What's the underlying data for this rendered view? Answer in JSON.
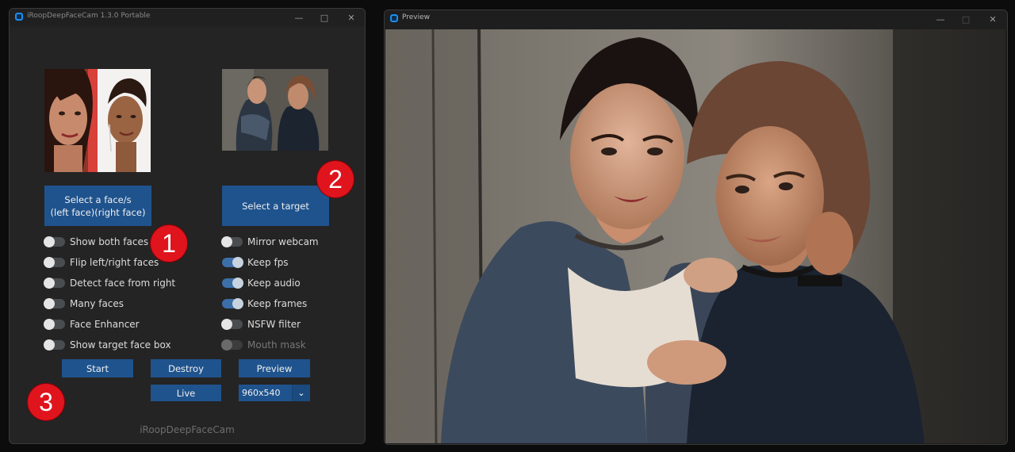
{
  "main_window": {
    "title": "iRoopDeepFaceCam 1.3.0 Portable",
    "source_button": "Select a face/s\n(left face)(right face)",
    "target_button": "Select a target",
    "left_switches": [
      {
        "label": "Show both faces",
        "on": false
      },
      {
        "label": "Flip left/right faces",
        "on": false
      },
      {
        "label": "Detect face from right",
        "on": false
      },
      {
        "label": "Many faces",
        "on": false
      },
      {
        "label": "Face Enhancer",
        "on": false
      },
      {
        "label": "Show target face box",
        "on": false
      }
    ],
    "right_switches": [
      {
        "label": "Mirror webcam",
        "on": false
      },
      {
        "label": "Keep fps",
        "on": true
      },
      {
        "label": "Keep audio",
        "on": true
      },
      {
        "label": "Keep frames",
        "on": true
      },
      {
        "label": "NSFW filter",
        "on": false
      },
      {
        "label": "Mouth mask",
        "on": false,
        "disabled": true
      }
    ],
    "start_button": "Start",
    "destroy_button": "Destroy",
    "preview_button": "Preview",
    "live_button": "Live",
    "resolution": "960x540",
    "footer": "iRoopDeepFaceCam"
  },
  "annotations": [
    "1",
    "2",
    "3"
  ],
  "preview_window": {
    "title": "Preview"
  },
  "colors": {
    "accent": "#1f538d",
    "badge": "#e0141c",
    "window_bg": "#242424"
  },
  "icons": {
    "minimize": "minimize-icon",
    "maximize": "maximize-icon",
    "close": "close-icon",
    "dropdown": "chevron-down-icon"
  }
}
